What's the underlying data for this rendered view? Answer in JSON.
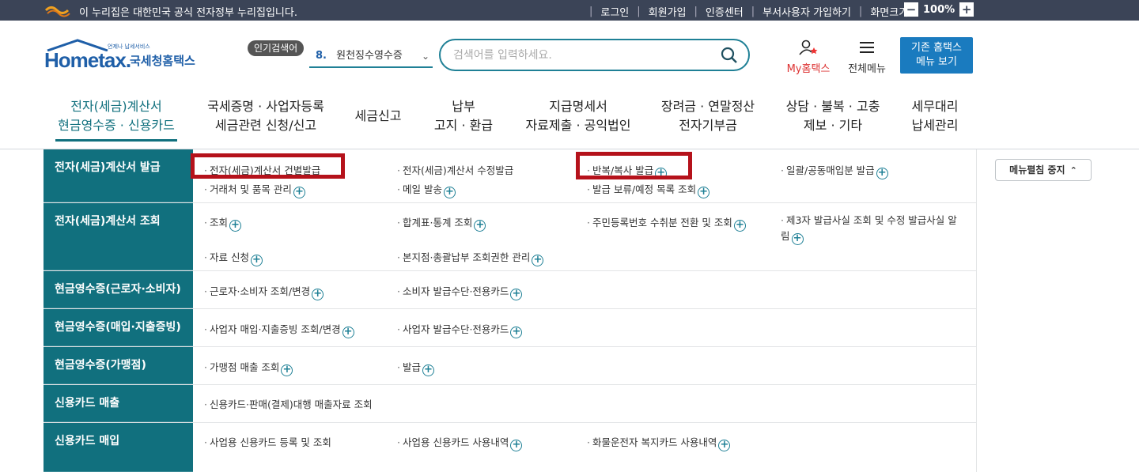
{
  "gov_bar": {
    "text": "이 누리집은 대한민국 공식 전자정부 누리집입니다.",
    "links": [
      "로그인",
      "회원가입",
      "인증센터",
      "부서사용자 가입하기",
      "화면크기"
    ],
    "zoom_minus": "−",
    "zoom_value": "100%",
    "zoom_plus": "+"
  },
  "brand": {
    "sub": "언제나 납세서비스",
    "main": "Hometax.",
    "kr": "국세청홈택스"
  },
  "popular": {
    "badge": "인기검색어",
    "num": "8.",
    "term": "원천징수영수증",
    "chevron": "⌄"
  },
  "search": {
    "placeholder": "검색어를 입력하세요."
  },
  "header_buttons": {
    "my_hometax": "My홈택스",
    "all_menu": "전체메뉴",
    "old_hometax_1": "기존 홈택스",
    "old_hometax_2": "메뉴 보기"
  },
  "gnb": [
    {
      "line1": "전자(세금)계산서",
      "line2": "현금영수증 · 신용카드"
    },
    {
      "line1": "국세증명 · 사업자등록",
      "line2": "세금관련 신청/신고"
    },
    {
      "line1": "세금신고",
      "line2": ""
    },
    {
      "line1": "납부",
      "line2": "고지 · 환급"
    },
    {
      "line1": "지급명세서",
      "line2": "자료제출 · 공익법인"
    },
    {
      "line1": "장려금 · 연말정산",
      "line2": "전자기부금"
    },
    {
      "line1": "상담 · 불복 · 고충",
      "line2": "제보 · 기타"
    },
    {
      "line1": "세무대리",
      "line2": "납세관리"
    }
  ],
  "menu": [
    {
      "head": "전자(세금)계산서 발급",
      "links": [
        "전자(세금)계산서 건별발급",
        "전자(세금)계산서 수정발급",
        "반복/복사 발급",
        "일괄/공동매입분 발급",
        "거래처 및 품목 관리",
        "메일 발송",
        "발급 보류/예정 목록 조회"
      ]
    },
    {
      "head": "전자(세금)계산서 조회",
      "links": [
        "조회",
        "합계표·통계 조회",
        "주민등록번호 수취분 전환 및 조회",
        "제3자 발급사실 조회 및 수정 발급사실 알림",
        "자료 신청",
        "본지점·총괄납부 조회권한 관리"
      ]
    },
    {
      "head": "현금영수증(근로자·소비자)",
      "links": [
        "근로자·소비자 조회/변경",
        "소비자 발급수단·전용카드"
      ]
    },
    {
      "head": "현금영수증(매입·지출증빙)",
      "links": [
        "사업자 매입·지출증빙 조회/변경",
        "사업자 발급수단·전용카드"
      ]
    },
    {
      "head": "현금영수증(가맹점)",
      "links": [
        "가맹점 매출 조회",
        "발급"
      ]
    },
    {
      "head": "신용카드 매출",
      "links": [
        "신용카드·판매(결제)대행 매출자료 조회"
      ]
    },
    {
      "head": "신용카드 매입",
      "links": [
        "사업용 신용카드 등록 및 조회",
        "사업용 신용카드 사용내역",
        "화물운전자 복지카드 사용내역"
      ]
    }
  ],
  "fold_button": "메뉴펼침 중지",
  "colors": {
    "teal": "#11707e",
    "highlight": "#b5121b",
    "gov_bar": "#3b4457",
    "blue_button": "#1a7bbf"
  }
}
